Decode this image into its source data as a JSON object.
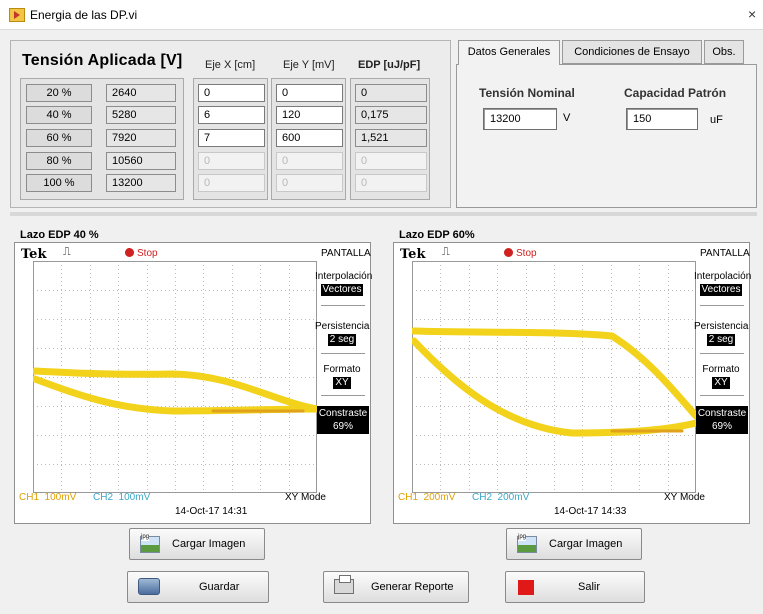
{
  "window": {
    "title": "Energia de las DP.vi",
    "close": "×"
  },
  "table": {
    "title": "Tensión Aplicada [V]",
    "headers": {
      "x": "Eje X [cm]",
      "y": "Eje Y [mV]",
      "edp": "EDP [uJ/pF]"
    },
    "rows": [
      {
        "pct": "20 %",
        "volt": "2640",
        "x": "0",
        "y": "0",
        "edp": "0"
      },
      {
        "pct": "40 %",
        "volt": "5280",
        "x": "6",
        "y": "120",
        "edp": "0,175"
      },
      {
        "pct": "60 %",
        "volt": "7920",
        "x": "7",
        "y": "600",
        "edp": "1,521"
      },
      {
        "pct": "80 %",
        "volt": "10560",
        "x": "0",
        "y": "0",
        "edp": "0"
      },
      {
        "pct": "100 %",
        "volt": "13200",
        "x": "0",
        "y": "0",
        "edp": "0"
      }
    ]
  },
  "tabs": {
    "items": [
      "Datos Generales",
      "Condiciones de Ensayo",
      "Obs."
    ],
    "nominal": {
      "label": "Tensión Nominal",
      "value": "13200",
      "unit": "V"
    },
    "capacidad": {
      "label": "Capacidad Patrón",
      "value": "150",
      "unit": "uF"
    }
  },
  "scopes": [
    {
      "label": "Lazo EDP 40 %",
      "brand": "Tek",
      "status": "Stop",
      "menu_title": "PANTALLA",
      "interp_label": "Interpolación",
      "interp_value": "Vectores",
      "pers_label": "Persistencia",
      "pers_value": "2 seg",
      "fmt_label": "Formato",
      "fmt_value": "XY",
      "contrast_label": "Constraste",
      "contrast_value": "69%",
      "ch1": "CH1  100mV",
      "ch2": "CH2  100mV",
      "mode": "XY Mode",
      "datetime": "14-Oct-17 14:31",
      "load_button": "Cargar Imagen"
    },
    {
      "label": "Lazo EDP 60%",
      "brand": "Tek",
      "status": "Stop",
      "menu_title": "PANTALLA",
      "interp_label": "Interpolación",
      "interp_value": "Vectores",
      "pers_label": "Persistencia",
      "pers_value": "2 seg",
      "fmt_label": "Formato",
      "fmt_value": "XY",
      "contrast_label": "Constraste",
      "contrast_value": "69%",
      "ch1": "CH1  200mV",
      "ch2": "CH2  200mV",
      "mode": "XY Mode",
      "datetime": "14-Oct-17 14:33",
      "load_button": "Cargar Imagen"
    }
  ],
  "buttons": {
    "save": "Guardar",
    "report": "Generar Reporte",
    "exit": "Salir",
    "jpg_tag": "jpg"
  },
  "colors": {
    "trace": "#f2d21a",
    "trace_dark": "#e0a21a",
    "ch1": "#e0a000",
    "ch2": "#3aa8c8"
  }
}
